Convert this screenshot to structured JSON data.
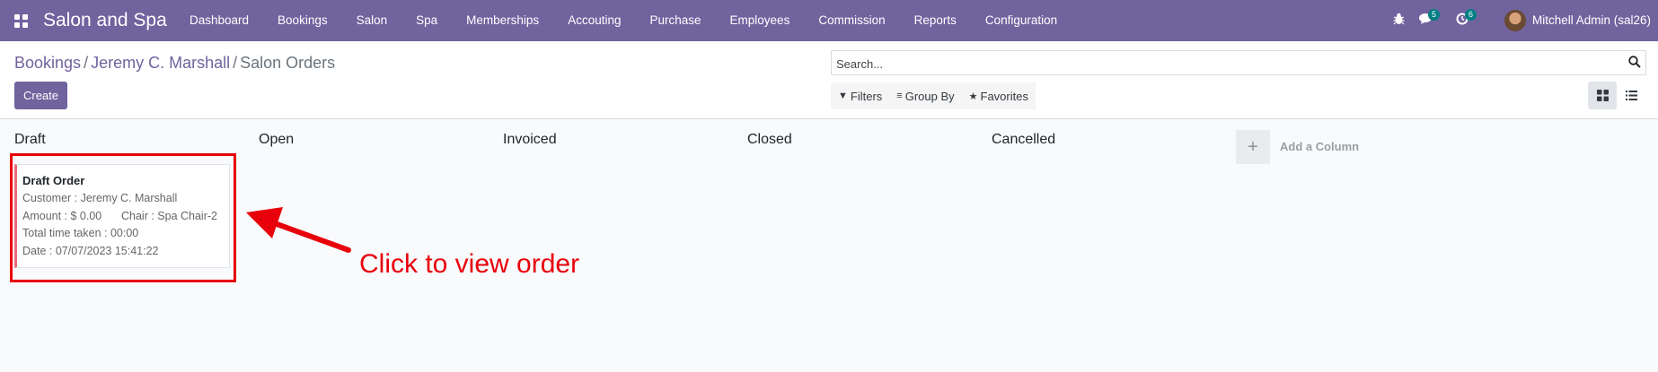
{
  "navbar": {
    "brand": "Salon and Spa",
    "menu": [
      "Dashboard",
      "Bookings",
      "Salon",
      "Spa",
      "Memberships",
      "Accouting",
      "Purchase",
      "Employees",
      "Commission",
      "Reports",
      "Configuration"
    ],
    "messages_count": "5",
    "activities_count": "6",
    "user": "Mitchell Admin (sal26)",
    "accent": "#71639e"
  },
  "breadcrumb": {
    "item1": "Bookings",
    "sep": "/",
    "item2": "Jeremy C. Marshall",
    "current": "Salon Orders"
  },
  "toolbar": {
    "create_label": "Create"
  },
  "search": {
    "placeholder": "Search...",
    "filters": "Filters",
    "group_by": "Group By",
    "favorites": "Favorites"
  },
  "kanban": {
    "columns": [
      "Draft",
      "Open",
      "Invoiced",
      "Closed",
      "Cancelled"
    ],
    "add_column": "Add a Column",
    "card": {
      "title": "Draft Order",
      "customer": "Customer : Jeremy C. Marshall",
      "amount": "Amount : $ 0.00",
      "chair": "Chair : Spa Chair-2",
      "time": "Total time taken : 00:00",
      "date": "Date : 07/07/2023 15:41:22"
    }
  },
  "annotation": {
    "text": "Click to view order",
    "color": "#e8000b"
  }
}
